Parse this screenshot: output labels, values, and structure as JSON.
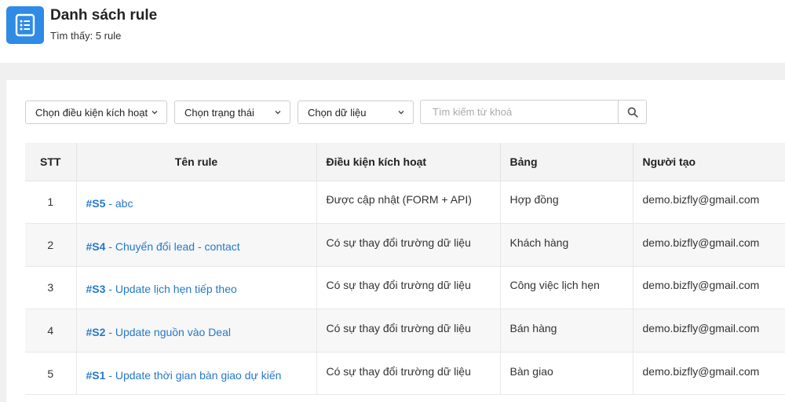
{
  "header": {
    "title": "Danh sách rule",
    "subtitle": "Tìm thấy: 5 rule",
    "icon": "list-document-icon",
    "accent": "#2e8be6"
  },
  "filters": {
    "trigger_select": "Chọn điều kiện kích hoạt",
    "status_select": "Chọn trạng thái",
    "data_select": "Chọn dữ liệu",
    "search_placeholder": "Tìm kiếm từ khoá"
  },
  "table": {
    "columns": {
      "stt": "STT",
      "name": "Tên rule",
      "trigger": "Điều kiện kích hoạt",
      "table": "Bảng",
      "creator": "Người tạo"
    },
    "rows": [
      {
        "stt": "1",
        "code": "#S5",
        "sep": " - ",
        "name": "abc",
        "trigger": "Được cập nhật (FORM + API)",
        "table": "Hợp đồng",
        "creator": "demo.bizfly@gmail.com"
      },
      {
        "stt": "2",
        "code": "#S4",
        "sep": " - ",
        "name": "Chuyển đổi lead - contact",
        "trigger": "Có sự thay đổi trường dữ liệu",
        "table": "Khách hàng",
        "creator": "demo.bizfly@gmail.com"
      },
      {
        "stt": "3",
        "code": "#S3",
        "sep": " - ",
        "name": "Update lịch hẹn tiếp theo",
        "trigger": "Có sự thay đổi trường dữ liệu",
        "table": "Công việc lịch hẹn",
        "creator": "demo.bizfly@gmail.com"
      },
      {
        "stt": "4",
        "code": "#S2",
        "sep": " - ",
        "name": "Update nguồn vào Deal",
        "trigger": "Có sự thay đổi trường dữ liệu",
        "table": "Bán hàng",
        "creator": "demo.bizfly@gmail.com"
      },
      {
        "stt": "5",
        "code": "#S1",
        "sep": " - ",
        "name": "Update thời gian bàn giao dự kiến",
        "trigger": "Có sự thay đổi trường dữ liệu",
        "table": "Bàn giao",
        "creator": "demo.bizfly@gmail.com"
      }
    ]
  }
}
